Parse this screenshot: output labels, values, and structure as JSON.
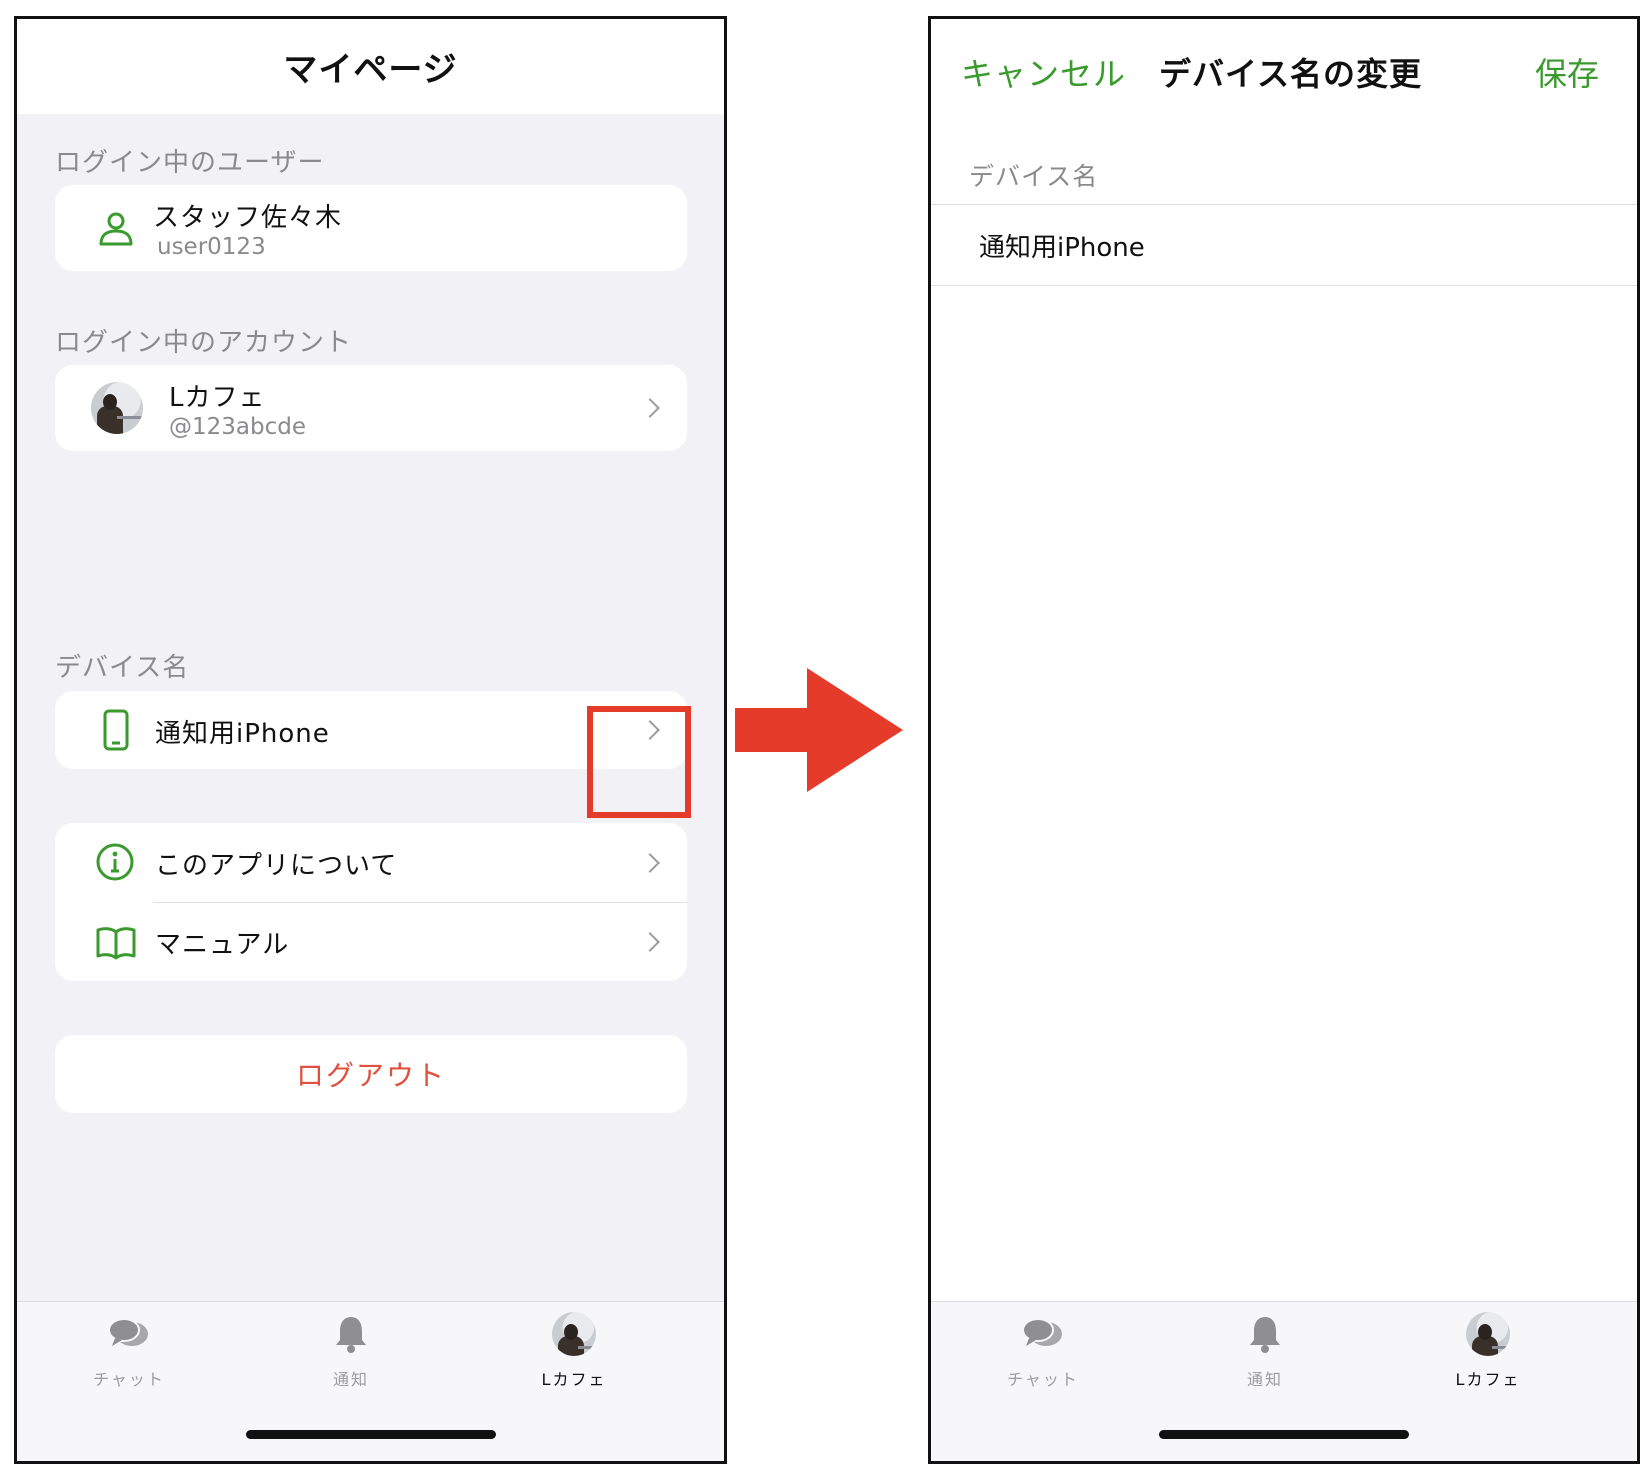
{
  "left": {
    "header": {
      "title": "マイページ"
    },
    "user_section": {
      "label": "ログイン中のユーザー",
      "name": "スタッフ佐々木",
      "id": "user0123",
      "icon": "person-icon"
    },
    "account_section": {
      "label": "ログイン中のアカウント",
      "name": "Lカフェ",
      "handle": "@123abcde"
    },
    "device_section": {
      "label": "デバイス名",
      "device_name": "通知用iPhone",
      "icon": "phone-icon"
    },
    "menu": [
      {
        "label": "このアプリについて",
        "icon": "info-icon"
      },
      {
        "label": "マニュアル",
        "icon": "book-icon"
      }
    ],
    "logout_label": "ログアウト"
  },
  "right": {
    "header": {
      "cancel": "キャンセル",
      "title": "デバイス名の変更",
      "save": "保存"
    },
    "field_label": "デバイス名",
    "field_value": "通知用iPhone"
  },
  "tabbar": {
    "tabs": [
      {
        "label": "チャット",
        "icon": "chat-icon"
      },
      {
        "label": "通知",
        "icon": "bell-icon"
      },
      {
        "label": "Lカフェ",
        "icon": "avatar"
      }
    ]
  },
  "colors": {
    "accent_green": "#3a9a2d",
    "logout_red": "#e0503f",
    "highlight_red": "#e53b2a",
    "background_gray": "#f2f2f6"
  }
}
